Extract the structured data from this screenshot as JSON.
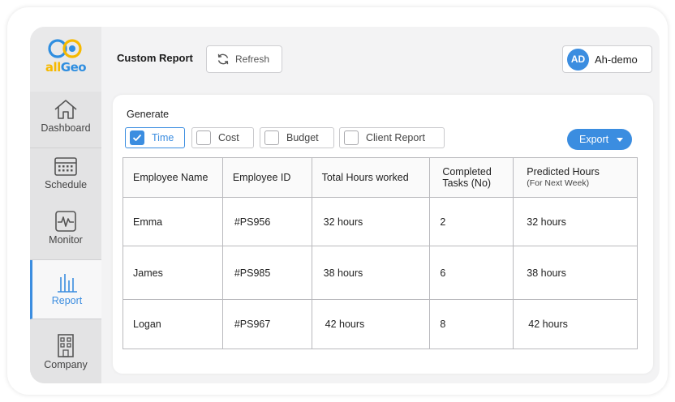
{
  "brand": {
    "logo_part1": "all",
    "logo_part2": "Geo"
  },
  "sidebar": {
    "items": [
      {
        "label": "Dashboard",
        "icon": "home-icon"
      },
      {
        "label": "Schedule",
        "icon": "calendar-icon"
      },
      {
        "label": "Monitor",
        "icon": "pulse-icon"
      },
      {
        "label": "Report",
        "icon": "bar-chart-icon",
        "active": true
      },
      {
        "label": "Company",
        "icon": "building-icon"
      }
    ]
  },
  "header": {
    "title": "Custom Report",
    "refresh_label": "Refresh",
    "user_initials": "AD",
    "user_name": "Ah-demo"
  },
  "generate": {
    "label": "Generate",
    "options": [
      {
        "label": "Time",
        "checked": true
      },
      {
        "label": "Cost",
        "checked": false
      },
      {
        "label": "Budget",
        "checked": false
      },
      {
        "label": "Client Report",
        "checked": false
      }
    ],
    "export_label": "Export"
  },
  "table": {
    "headers": [
      {
        "label": "Employee Name"
      },
      {
        "label": "Employee ID"
      },
      {
        "label": "Total Hours worked"
      },
      {
        "label": "Completed Tasks (No)"
      },
      {
        "label": "Predicted Hours",
        "sub": "(For Next Week)"
      }
    ],
    "rows": [
      [
        "Emma",
        "#PS956",
        "32 hours",
        "2",
        "32 hours"
      ],
      [
        "James",
        "#PS985",
        "38 hours",
        "6",
        "38 hours"
      ],
      [
        "Logan",
        "#PS967",
        "42 hours",
        "8",
        "42 hours"
      ]
    ]
  },
  "colors": {
    "accent": "#3b8de0",
    "logo_yellow": "#f6b900"
  }
}
